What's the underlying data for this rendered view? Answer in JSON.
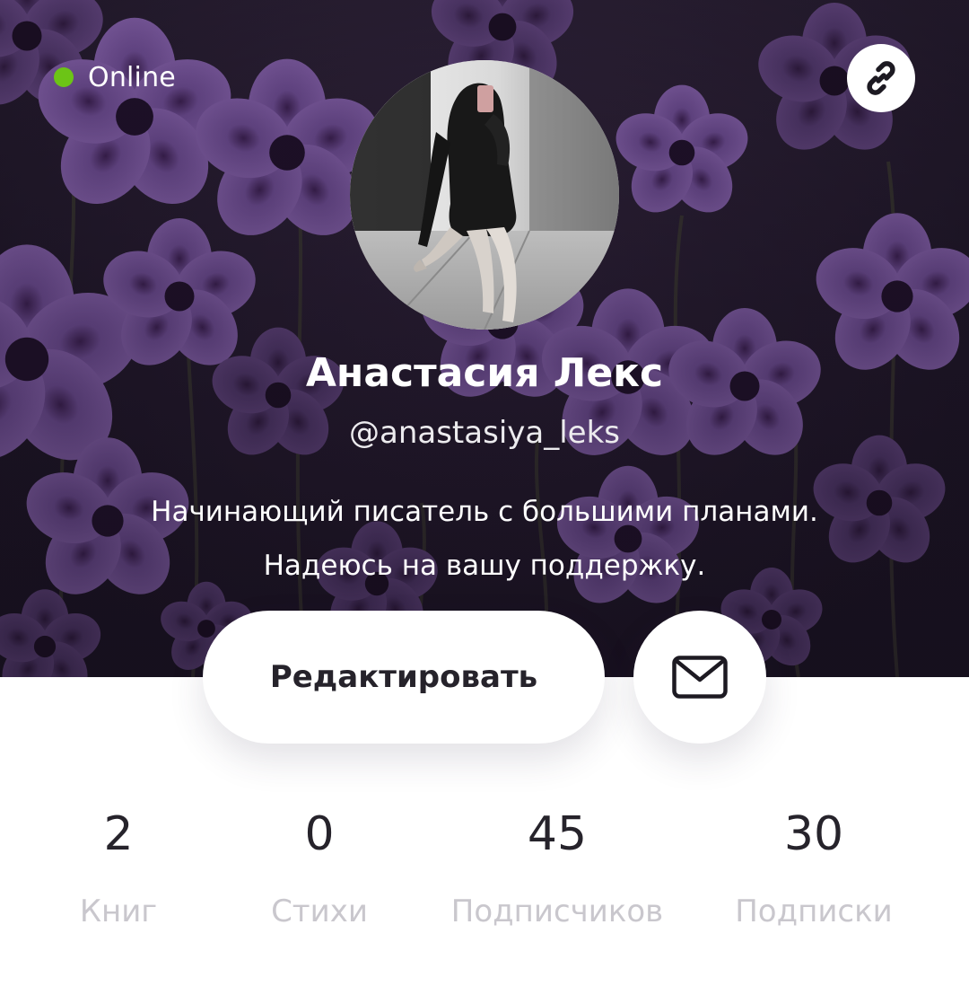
{
  "status": {
    "label": "Online",
    "color": "#6cc416"
  },
  "profile": {
    "name": "Анастасия Лекс",
    "username": "@anastasiya_leks",
    "bio_line1": "Начинающий писатель с большими планами.",
    "bio_line2": "Надеюсь на вашу поддержку."
  },
  "actions": {
    "edit_label": "Редактировать",
    "message_icon": "mail-icon",
    "share_icon": "link-icon"
  },
  "stats": [
    {
      "count": "2",
      "label": "Книг"
    },
    {
      "count": "0",
      "label": "Стихи"
    },
    {
      "count": "45",
      "label": "Подписчиков"
    },
    {
      "count": "30",
      "label": "Подписки"
    }
  ],
  "colors": {
    "accent_dark": "#26232b",
    "muted": "#c9c7cd",
    "cover": "#2e2338",
    "flower": "#6b4a8a"
  }
}
